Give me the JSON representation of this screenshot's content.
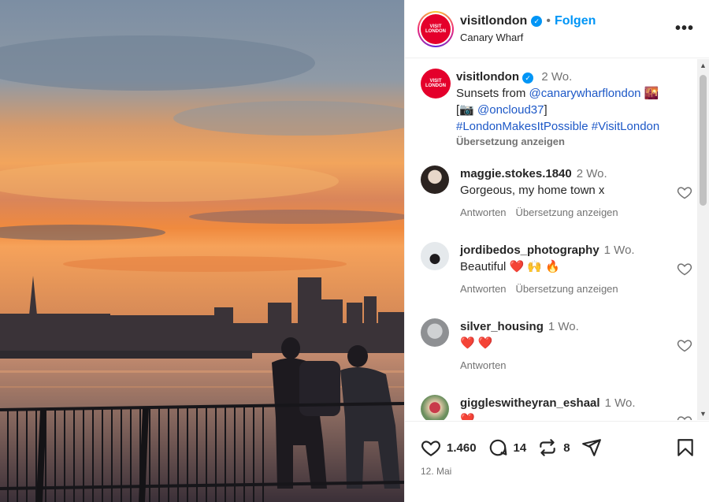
{
  "header": {
    "username": "visitlondon",
    "separator": "•",
    "follow_label": "Folgen",
    "location": "Canary Wharf",
    "more_label": "•••",
    "logo_text": "VISIT\nLONDON"
  },
  "caption": {
    "username": "visitlondon",
    "time": "2 Wo.",
    "line1": "Sunsets from ",
    "mention1": "@canarywharflondon",
    "line1_emoji": "🌇",
    "line2_prefix": "[📷 ",
    "mention2": "@oncloud37",
    "line2_suffix": "]",
    "hashtags": "#LondonMakesItPossible #VisitLondon",
    "translate": "Übersetzung anzeigen"
  },
  "comments": [
    {
      "username": "maggie.stokes.1840",
      "time": "2 Wo.",
      "text": "Gorgeous, my home town x",
      "reply": "Antworten",
      "translate": "Übersetzung anzeigen"
    },
    {
      "username": "jordibedos_photography",
      "time": "1 Wo.",
      "text": "Beautiful ❤️ 🙌 🔥",
      "reply": "Antworten",
      "translate": "Übersetzung anzeigen"
    },
    {
      "username": "silver_housing",
      "time": "1 Wo.",
      "text": "❤️ ❤️",
      "reply": "Antworten",
      "translate": ""
    },
    {
      "username": "giggleswitheyran_eshaal",
      "time": "1 Wo.",
      "text": "❤️",
      "reply": "",
      "translate": ""
    }
  ],
  "stats": {
    "likes": "1.460",
    "comments": "14",
    "reposts": "8"
  },
  "date": "12. Mai",
  "colors": {
    "accent": "#0095f6",
    "brand": "#e4002b",
    "heart": "#ed4956"
  }
}
